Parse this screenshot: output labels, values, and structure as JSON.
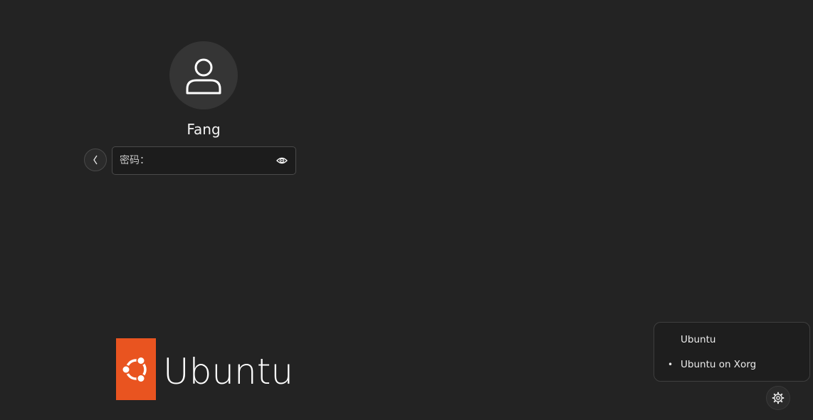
{
  "login": {
    "username": "Fang",
    "password_placeholder": "密码："
  },
  "icons": {
    "avatar": "user-icon",
    "back": "chevron-left-icon",
    "reveal": "eye-icon",
    "settings": "gear-icon",
    "logo": "ubuntu-circle-of-friends-icon"
  },
  "logo": {
    "text": "Ubuntu"
  },
  "session_menu": {
    "items": [
      {
        "label": "Ubuntu",
        "selected": false
      },
      {
        "label": "Ubuntu on Xorg",
        "selected": true
      }
    ],
    "bullet": "•"
  },
  "colors": {
    "background": "#232323",
    "brand_orange": "#e95420"
  }
}
